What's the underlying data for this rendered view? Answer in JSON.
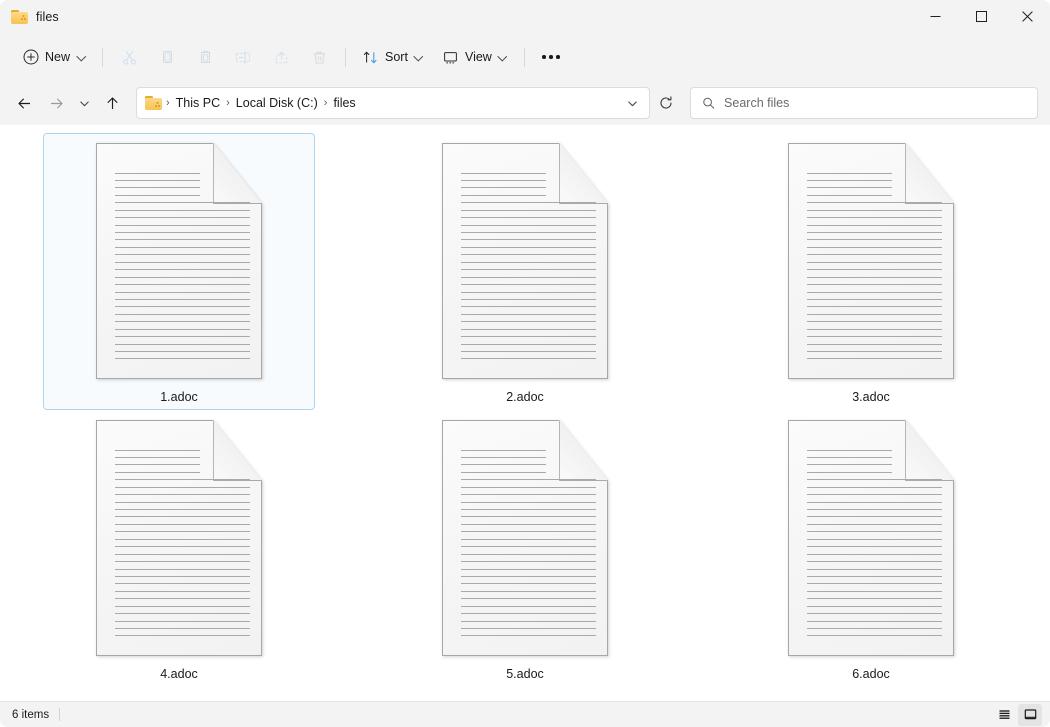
{
  "window": {
    "title": "files",
    "folder_icon": "folder-icon",
    "controls": {
      "minimize": "minimize-icon",
      "maximize": "maximize-icon",
      "close": "close-icon"
    }
  },
  "toolbar": {
    "new_label": "New",
    "sort_label": "Sort",
    "view_label": "View",
    "items": [
      {
        "name": "new-button",
        "label": "New",
        "icon": "plus-circle-icon",
        "disabled": false
      },
      {
        "name": "cut-button",
        "label": "Cut",
        "icon": "scissors-icon",
        "disabled": true
      },
      {
        "name": "copy-button",
        "label": "Copy",
        "icon": "copy-icon",
        "disabled": true
      },
      {
        "name": "paste-button",
        "label": "Paste",
        "icon": "clipboard-icon",
        "disabled": true
      },
      {
        "name": "rename-button",
        "label": "Rename",
        "icon": "rename-icon",
        "disabled": true
      },
      {
        "name": "share-button",
        "label": "Share",
        "icon": "share-icon",
        "disabled": true
      },
      {
        "name": "delete-button",
        "label": "Delete",
        "icon": "trash-icon",
        "disabled": true
      },
      {
        "name": "sort-button",
        "label": "Sort",
        "icon": "sort-arrows-icon",
        "disabled": false
      },
      {
        "name": "view-button",
        "label": "View",
        "icon": "monitor-icon",
        "disabled": false
      },
      {
        "name": "more-button",
        "label": "See more",
        "icon": "ellipsis-icon",
        "disabled": false
      }
    ]
  },
  "navigation": {
    "back": "back-arrow-icon",
    "forward": "forward-arrow-icon",
    "recent": "chevron-down-icon",
    "up": "up-arrow-icon",
    "refresh": "refresh-icon",
    "breadcrumb_dropdown": "chevron-down-icon",
    "breadcrumb": [
      "This PC",
      "Local Disk (C:)",
      "files"
    ],
    "separator": "›"
  },
  "search": {
    "placeholder": "Search files",
    "value": "",
    "icon": "search-icon"
  },
  "files": [
    {
      "name": "1.adoc",
      "type": "adoc",
      "icon": "document-icon",
      "selected": true
    },
    {
      "name": "2.adoc",
      "type": "adoc",
      "icon": "document-icon",
      "selected": false
    },
    {
      "name": "3.adoc",
      "type": "adoc",
      "icon": "document-icon",
      "selected": false
    },
    {
      "name": "4.adoc",
      "type": "adoc",
      "icon": "document-icon",
      "selected": false
    },
    {
      "name": "5.adoc",
      "type": "adoc",
      "icon": "document-icon",
      "selected": false
    },
    {
      "name": "6.adoc",
      "type": "adoc",
      "icon": "document-icon",
      "selected": false
    }
  ],
  "statusbar": {
    "item_count": "6 items",
    "details_view": "details-view-icon",
    "icons_view": "large-icons-view-icon",
    "active_view": "icons"
  },
  "colors": {
    "chrome_bg": "#f3f3f3",
    "content_bg": "#ffffff",
    "selection_border": "#aad6f0",
    "selection_fill": "#f7fbfe",
    "accent_blue": "#4aa3e8",
    "folder_yellow": "#f7c351",
    "text": "#1a1a1a"
  },
  "icon_geometry": {
    "doc_short_lines": 4,
    "doc_long_lines": 22
  }
}
